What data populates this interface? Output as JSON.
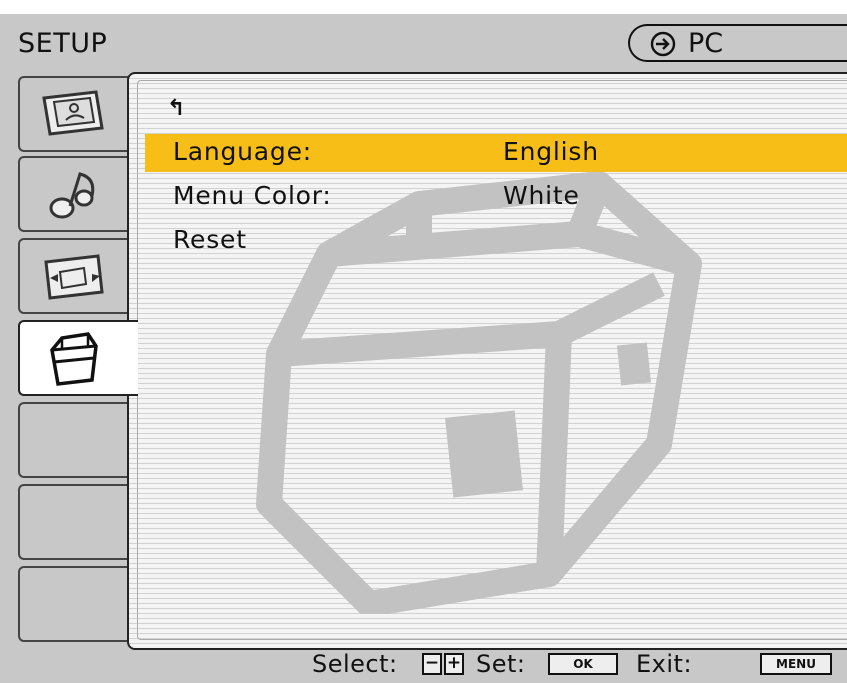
{
  "header": {
    "title": "SETUP",
    "source_icon": "input-arrow-icon",
    "source_label": "PC"
  },
  "sidebar": {
    "tabs": [
      {
        "name": "picture-icon",
        "active": false
      },
      {
        "name": "sound-icon",
        "active": false
      },
      {
        "name": "screen-icon",
        "active": false
      },
      {
        "name": "setup-toolbox-icon",
        "active": true
      },
      {
        "name": "empty",
        "active": false
      },
      {
        "name": "empty",
        "active": false
      },
      {
        "name": "empty",
        "active": false
      }
    ]
  },
  "menu": {
    "back_icon": "↰",
    "items": [
      {
        "label": "Language:",
        "value": "English",
        "highlighted": true
      },
      {
        "label": "Menu Color:",
        "value": "White",
        "highlighted": false
      },
      {
        "label": "Reset",
        "value": "",
        "highlighted": false
      }
    ]
  },
  "footer": {
    "select_label": "Select:",
    "minus_key": "−",
    "plus_key": "+",
    "set_label": "Set:",
    "ok_key": "OK",
    "exit_label": "Exit:",
    "menu_key": "MENU"
  },
  "colors": {
    "highlight": "#f7be18",
    "background": "#c8c8c8"
  }
}
